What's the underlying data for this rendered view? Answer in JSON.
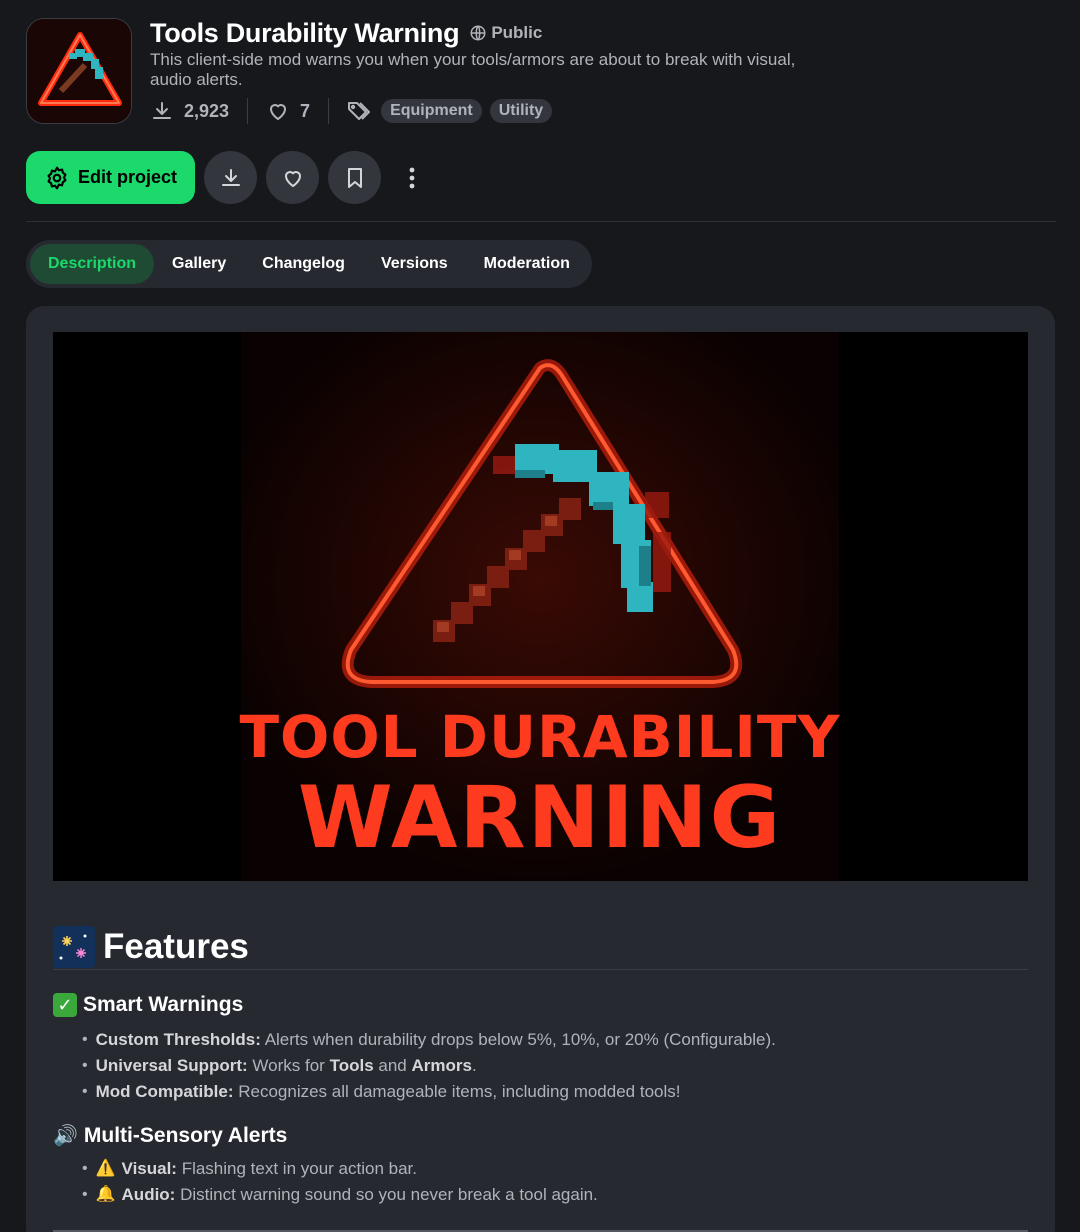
{
  "project": {
    "title": "Tools Durability Warning",
    "visibility": "Public",
    "summary": "This client-side mod warns you when your tools/armors are about to break with visual, audio alerts.",
    "downloads": "2,923",
    "likes": "7",
    "tags": [
      "Equipment",
      "Utility"
    ]
  },
  "actions": {
    "edit_label": "Edit project"
  },
  "tabs": [
    {
      "label": "Description",
      "active": true
    },
    {
      "label": "Gallery",
      "active": false
    },
    {
      "label": "Changelog",
      "active": false
    },
    {
      "label": "Versions",
      "active": false
    },
    {
      "label": "Moderation",
      "active": false
    }
  ],
  "hero": {
    "line1": "TOOL DURABILITY",
    "line2": "WARNING"
  },
  "description": {
    "features_title": "Features",
    "smart_title": "Smart Warnings",
    "smart_items": [
      {
        "bold": "Custom Thresholds:",
        "text": " Alerts when durability drops below 5%, 10%, or 20% (Configurable)."
      },
      {
        "bold": "Universal Support:",
        "text": " Works for ",
        "bold2": "Tools",
        "text2": " and ",
        "bold3": "Armors",
        "text3": "."
      },
      {
        "bold": "Mod Compatible:",
        "text": " Recognizes all damageable items, including modded tools!"
      }
    ],
    "alerts_title": "Multi-Sensory Alerts",
    "alert_items": [
      {
        "emoji": "⚠️",
        "bold": "Visual:",
        "text": " Flashing text in your action bar."
      },
      {
        "emoji": "🔔",
        "bold": "Audio:",
        "text": " Distinct warning sound so you never break a tool again."
      }
    ]
  },
  "colors": {
    "accent": "#1bd96a",
    "background": "#16181c",
    "card": "#26292f",
    "neon_red": "#ff3b1f",
    "pickaxe_cyan": "#2fb5c0"
  }
}
